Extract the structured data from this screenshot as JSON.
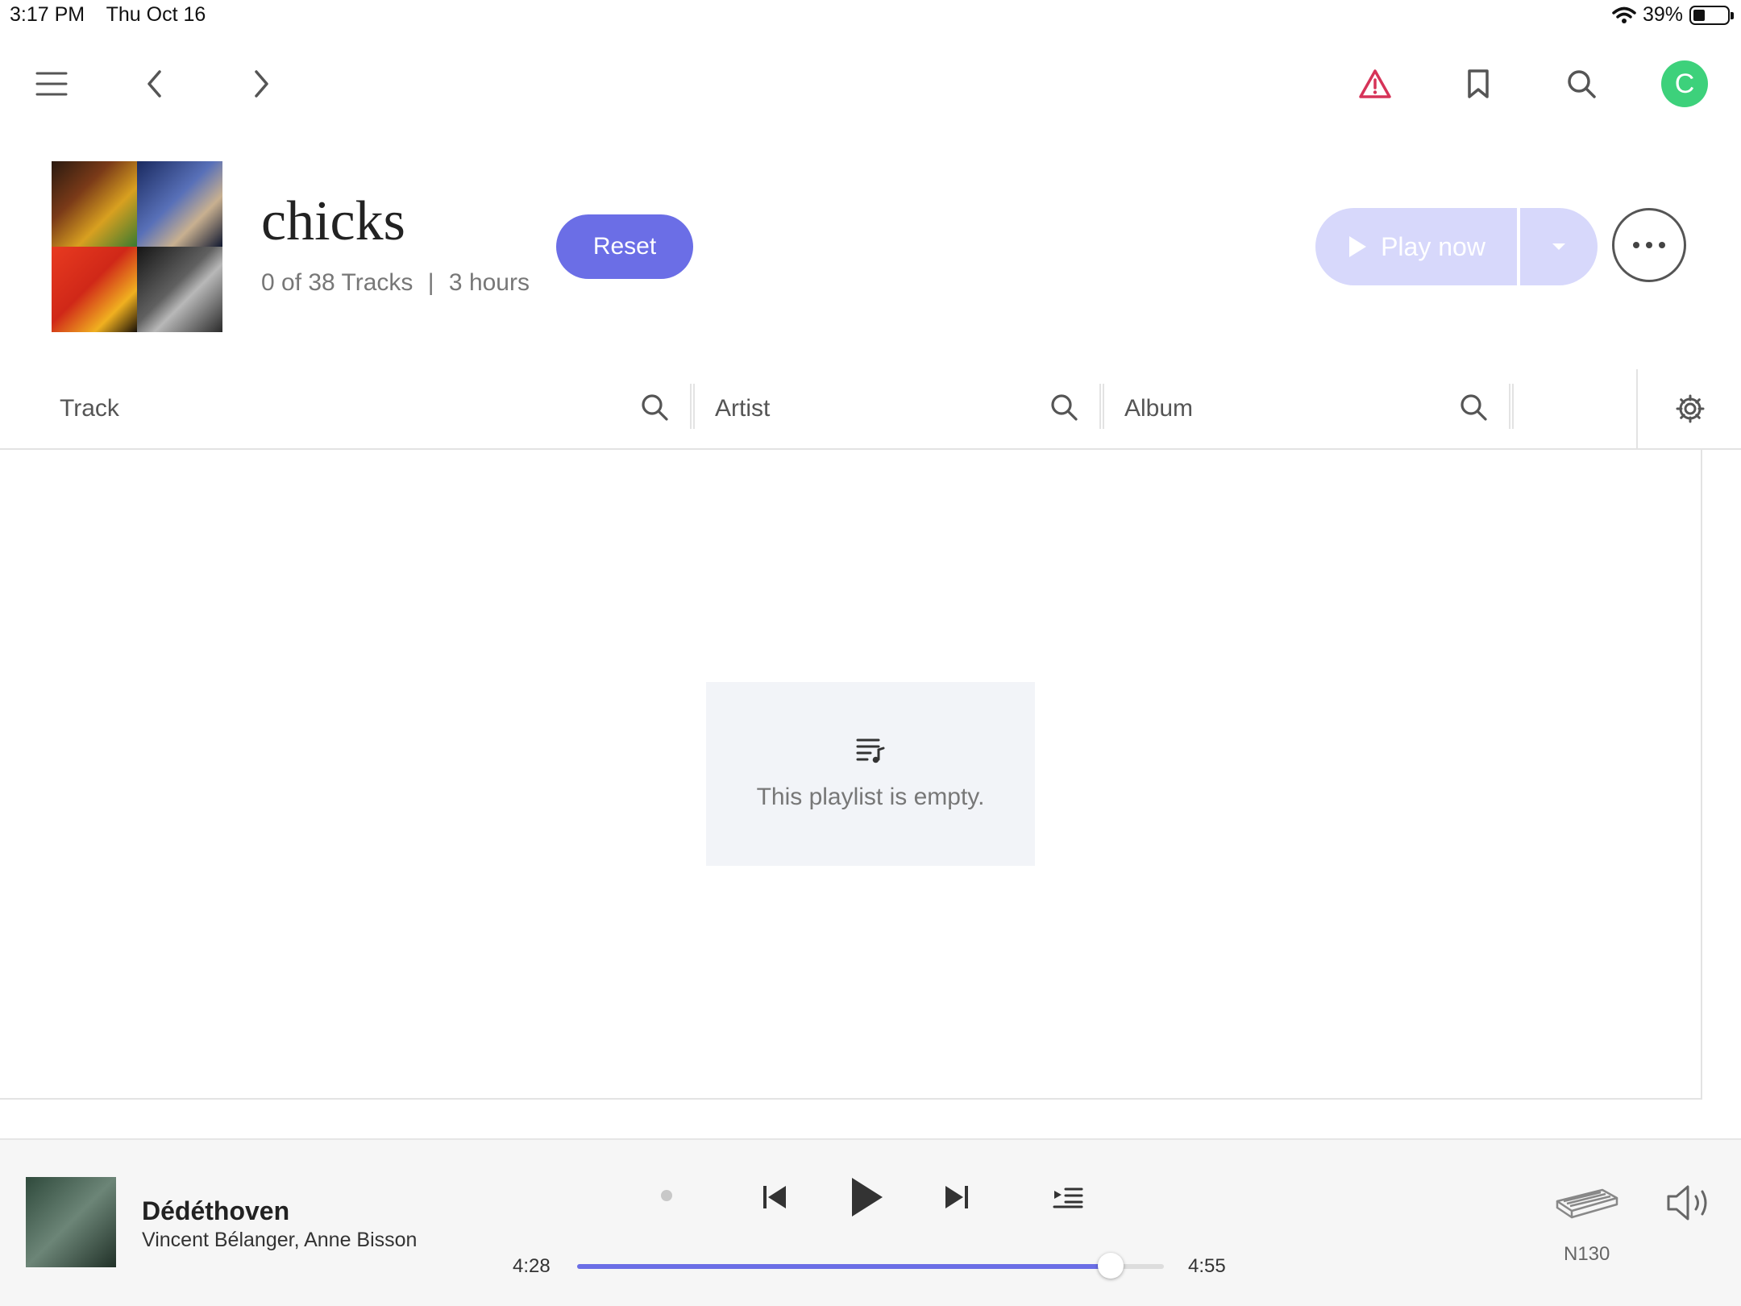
{
  "status_bar": {
    "time": "3:17 PM",
    "date": "Thu Oct 16",
    "battery": "39%",
    "icons": [
      "wifi-icon",
      "battery-icon"
    ]
  },
  "toolbar": {
    "icons": [
      "hamburger-menu-icon",
      "back-arrow-icon",
      "forward-arrow-icon",
      "warning-icon",
      "bookmark-icon",
      "search-icon"
    ],
    "avatar_letter": "C",
    "avatar_color": "#3dd17b",
    "warning_color": "#d63358"
  },
  "playlist": {
    "title": "chicks",
    "track_count": "0 of 38 Tracks",
    "separator": "|",
    "duration": "3 hours",
    "reset_label": "Reset",
    "play_label": "Play now",
    "accent_color": "#6b6ee6"
  },
  "columns": {
    "track": "Track",
    "artist": "Artist",
    "album": "Album"
  },
  "empty_state": {
    "message": "This playlist is empty.",
    "icon": "playlist-music-icon"
  },
  "now_playing": {
    "title": "Dédéthoven",
    "artist": "Vincent Bélanger, Anne Bisson",
    "elapsed": "4:28",
    "total": "4:55",
    "progress": 0.91,
    "zone": "N130"
  }
}
